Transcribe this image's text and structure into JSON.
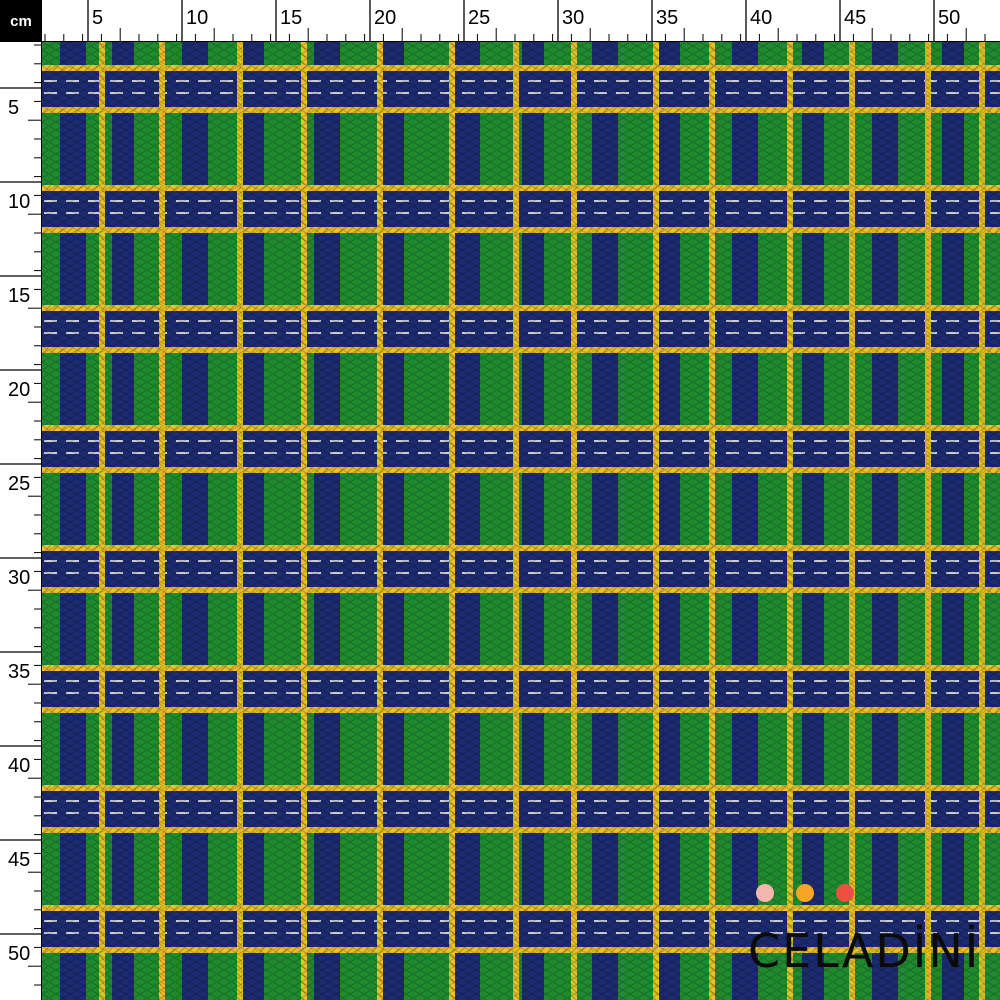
{
  "ruler": {
    "unit": "cm",
    "top_labels": [
      "5",
      "10",
      "15",
      "20",
      "25",
      "30",
      "35",
      "40",
      "45",
      "50"
    ],
    "left_labels": [
      "5",
      "10",
      "15",
      "20",
      "25",
      "30",
      "35",
      "40",
      "45",
      "50"
    ]
  },
  "fabric": {
    "pattern": "tartan plaid",
    "colors": {
      "green": "#1f8a2e",
      "navy": "#1c2a6e",
      "yellow": "#e8c22a",
      "white": "#e8e8e8"
    }
  },
  "brand": {
    "name": "CELADİNİ",
    "dot_colors": [
      "#f2b8b0",
      "#f5a623",
      "#ee5040"
    ]
  }
}
